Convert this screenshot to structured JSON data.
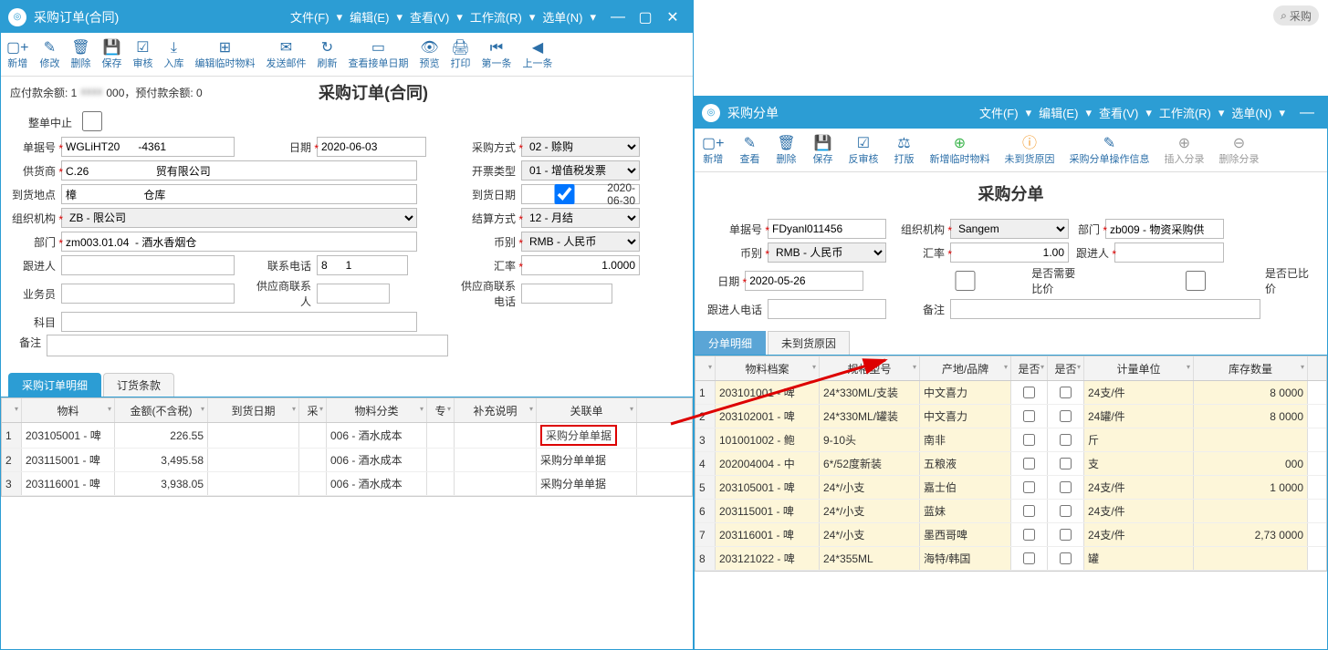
{
  "leftWindow": {
    "title": "采购订单(合同)",
    "menus": [
      "文件(F)",
      "编辑(E)",
      "查看(V)",
      "工作流(R)",
      "选单(N)"
    ],
    "toolbar": [
      {
        "icon": "▢+",
        "label": "新增"
      },
      {
        "icon": "✎",
        "label": "修改"
      },
      {
        "icon": "🗑",
        "label": "删除"
      },
      {
        "icon": "💾",
        "label": "保存"
      },
      {
        "icon": "☑",
        "label": "审核"
      },
      {
        "icon": "⤓",
        "label": "入库"
      },
      {
        "icon": "⊞",
        "label": "编辑临时物料"
      },
      {
        "icon": "✉",
        "label": "发送邮件"
      },
      {
        "icon": "↻",
        "label": "刷新"
      },
      {
        "icon": "▭",
        "label": "查看接单日期"
      },
      {
        "icon": "👁",
        "label": "预览"
      },
      {
        "icon": "🖨",
        "label": "打印"
      },
      {
        "icon": "⏮",
        "label": "第一条"
      },
      {
        "icon": "◀",
        "label": "上一条"
      }
    ],
    "balanceText": "应付款余额: 1",
    "balanceText2": "000，预付款余额: 0",
    "pageTitle": "采购订单(合同)",
    "wholeAbortLabel": "整单中止",
    "fields": {
      "docNoLabel": "单据号",
      "docNo": "WGLiHT20      -4361",
      "dateLabel": "日期",
      "date": "2020-06-03",
      "purchaseTypeLabel": "采购方式",
      "purchaseType": "02 - 赊购",
      "supplierLabel": "供货商",
      "supplier": "C.26                      贸有限公司",
      "invoiceTypeLabel": "开票类型",
      "invoiceType": "01 - 增值税发票",
      "arrivalPlaceLabel": "到货地点",
      "arrivalPlace": "樟                      仓库",
      "arrivalDateLabel": "到货日期",
      "arrivalDate": "2020-06-30",
      "orgLabel": "组织机构",
      "org": "ZB -                              限公司",
      "settlementLabel": "结算方式",
      "settlement": "12 - 月结",
      "deptLabel": "部门",
      "dept": "zm003.01.04  - 酒水香烟仓",
      "currencyLabel": "币别",
      "currency": "RMB - 人民币",
      "followerLabel": "跟进人",
      "follower": "",
      "phoneLabel": "联系电话",
      "phone": "8      1",
      "rateLabel": "汇率",
      "rate": "1.0000",
      "bizLabel": "业务员",
      "biz": "",
      "supContactLabel": "供应商联系人",
      "supContact": "",
      "subjectLabel": "科目",
      "subject": "",
      "supPhoneLabel": "供应商联系电话",
      "supPhone": "",
      "remarkLabel": "备注",
      "remark": ""
    },
    "tabs": [
      "采购订单明细",
      "订货条款"
    ],
    "gridHeaders": [
      "",
      "物料",
      "金额(不含税)",
      "到货日期",
      "采",
      "物料分类",
      "专",
      "补充说明",
      "关联单"
    ],
    "gridRows": [
      {
        "n": "1",
        "mat": "203105001 - 啤",
        "amt": "226.55",
        "arr": "",
        "c": "",
        "cat": "006 - 酒水成本",
        "s": "",
        "add": "",
        "link": "采购分单单据"
      },
      {
        "n": "2",
        "mat": "203115001 - 啤",
        "amt": "3,495.58",
        "arr": "",
        "c": "",
        "cat": "006 - 酒水成本",
        "s": "",
        "add": "",
        "link": "采购分单单据"
      },
      {
        "n": "3",
        "mat": "203116001 - 啤",
        "amt": "3,938.05",
        "arr": "",
        "c": "",
        "cat": "006 - 酒水成本",
        "s": "",
        "add": "",
        "link": "采购分单单据"
      }
    ]
  },
  "rightWindow": {
    "title": "采购分单",
    "menus": [
      "文件(F)",
      "编辑(E)",
      "查看(V)",
      "工作流(R)",
      "选单(N)"
    ],
    "toolbar": [
      {
        "icon": "▢+",
        "label": "新增",
        "cls": ""
      },
      {
        "icon": "✎",
        "label": "查看",
        "cls": ""
      },
      {
        "icon": "🗑",
        "label": "删除",
        "cls": ""
      },
      {
        "icon": "💾",
        "label": "保存",
        "cls": ""
      },
      {
        "icon": "☑",
        "label": "反审核",
        "cls": ""
      },
      {
        "icon": "⚖",
        "label": "打版",
        "cls": ""
      },
      {
        "icon": "⊕",
        "label": "新增临时物料",
        "cls": "green"
      },
      {
        "icon": "ⓘ",
        "label": "未到货原因",
        "cls": "orange"
      },
      {
        "icon": "✎",
        "label": "采购分单操作信息",
        "cls": ""
      },
      {
        "icon": "⊕",
        "label": "插入分录",
        "cls": "gray"
      },
      {
        "icon": "⊖",
        "label": "删除分录",
        "cls": "gray"
      }
    ],
    "pageTitle": "采购分单",
    "fields": {
      "docNoLabel": "单据号",
      "docNo": "FDyanl011456",
      "orgLabel": "组织机构",
      "org": "Sangem",
      "deptLabel": "部门",
      "dept": "zb009 - 物资采购供",
      "currencyLabel": "币别",
      "currency": "RMB - 人民币",
      "rateLabel": "汇率",
      "rate": "1.00",
      "followerLabel": "跟进人",
      "follower": "",
      "dateLabel": "日期",
      "date": "2020-05-26",
      "needCompareLabel": "是否需要比价",
      "comparedLabel": "是否已比价",
      "followerPhoneLabel": "跟进人电话",
      "followerPhone": "",
      "remarkLabel": "备注",
      "remark": ""
    },
    "tabs": [
      "分单明细",
      "未到货原因"
    ],
    "gridHeaders": [
      "",
      "物料档案",
      "规格型号",
      "产地/品牌",
      "是否",
      "是否",
      "计量单位",
      "库存数量"
    ],
    "gridRows": [
      {
        "n": "1",
        "mat": "203101001 - 啤",
        "spec": "24*330ML/支装",
        "brand": "中文喜力",
        "unit": "24支/件",
        "stock": "8      0000"
      },
      {
        "n": "2",
        "mat": "203102001 - 啤",
        "spec": "24*330ML/罐装",
        "brand": "中文喜力",
        "unit": "24罐/件",
        "stock": "8      0000"
      },
      {
        "n": "3",
        "mat": "101001002 - 鲍",
        "spec": "9-10头",
        "brand": "南非",
        "unit": "斤",
        "stock": ""
      },
      {
        "n": "4",
        "mat": "202004004 - 中",
        "spec": "6*/52度新装",
        "brand": "五粮液",
        "unit": "支",
        "stock": "000"
      },
      {
        "n": "5",
        "mat": "203105001 - 啤",
        "spec": "24*/小支",
        "brand": "嘉士伯",
        "unit": "24支/件",
        "stock": "1      0000"
      },
      {
        "n": "6",
        "mat": "203115001 - 啤",
        "spec": "24*/小支",
        "brand": "蓝妹",
        "unit": "24支/件",
        "stock": ""
      },
      {
        "n": "7",
        "mat": "203116001 - 啤",
        "spec": "24*/小支",
        "brand": "墨西哥啤",
        "unit": "24支/件",
        "stock": "2,73   0000"
      },
      {
        "n": "8",
        "mat": "203121022 - 啤",
        "spec": "24*355ML",
        "brand": "海特/韩国",
        "unit": "罐",
        "stock": ""
      }
    ]
  },
  "searchHint": "采购"
}
